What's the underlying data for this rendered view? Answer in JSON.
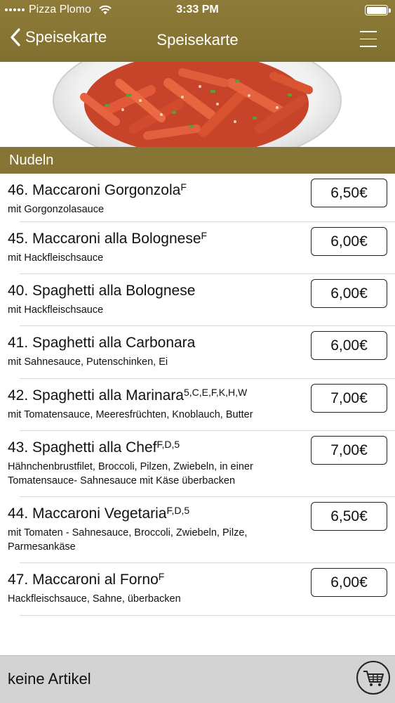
{
  "status_bar": {
    "carrier": "Pizza Plomo",
    "time": "3:33 PM"
  },
  "nav": {
    "back_label": "Speisekarte",
    "title": "Speisekarte"
  },
  "section": {
    "title": "Nudeln"
  },
  "items": [
    {
      "name": "46. Maccaroni Gorgonzola",
      "allergens": "F",
      "description": "mit Gorgonzolasauce",
      "price": "6,50€"
    },
    {
      "name": "45. Maccaroni alla Bolognese",
      "allergens": "F",
      "description": "mit Hackfleischsauce",
      "price": "6,00€"
    },
    {
      "name": "40. Spaghetti alla Bolognese",
      "allergens": "",
      "description": "mit Hackfleischsauce",
      "price": "6,00€"
    },
    {
      "name": "41. Spaghetti alla Carbonara",
      "allergens": "",
      "description": "mit Sahnesauce, Putenschinken, Ei",
      "price": "6,00€"
    },
    {
      "name": "42. Spaghetti alla Marinara",
      "allergens": "5,C,E,F,K,H,W",
      "description": "mit Tomatensauce, Meeresfrüchten, Knoblauch, Butter",
      "price": "7,00€"
    },
    {
      "name": "43. Spaghetti alla Chef",
      "allergens": "F,D,5",
      "description": "Hähnchenbrustfilet, Broccoli, Pilzen, Zwiebeln, in einer Tomatensauce- Sahnesauce mit Käse überbacken",
      "price": "7,00€"
    },
    {
      "name": "44. Maccaroni Vegetaria",
      "allergens": "F,D,5",
      "description": "mit Tomaten - Sahnesauce, Broccoli, Zwiebeln, Pilze, Parmesankäse",
      "price": "6,50€"
    },
    {
      "name": "47. Maccaroni al Forno",
      "allergens": "F",
      "description": "Hackfleischsauce, Sahne, überbacken",
      "price": "6,00€"
    }
  ],
  "footer": {
    "cart_status": "keine Artikel"
  },
  "icons": {
    "back": "chevron-left-icon",
    "menu": "hamburger-menu-icon",
    "cart": "shopping-cart-icon",
    "wifi": "wifi-icon",
    "battery": "battery-icon"
  },
  "colors": {
    "header": "#8e7b39",
    "section_bar": "#877535",
    "footer": "#d3d3d3"
  }
}
